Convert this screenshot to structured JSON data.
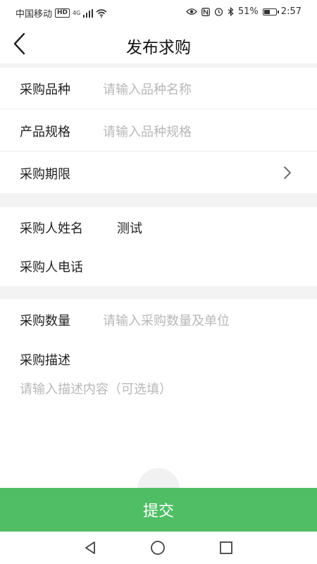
{
  "status_bar": {
    "carrier": "中国移动",
    "hd": "HD",
    "network": "4G",
    "battery_percent": "51%",
    "time": "2:57",
    "battery_level": 0.51
  },
  "header": {
    "title": "发布求购"
  },
  "form": {
    "variety": {
      "label": "采购品种",
      "placeholder": "请输入品种名称"
    },
    "spec": {
      "label": "产品规格",
      "placeholder": "请输入品种规格"
    },
    "period": {
      "label": "采购期限"
    },
    "buyer_name": {
      "label": "采购人姓名",
      "value": "测试"
    },
    "buyer_phone": {
      "label": "采购人电话"
    },
    "quantity": {
      "label": "采购数量",
      "placeholder": "请输入采购数量及单位"
    },
    "description": {
      "label": "采购描述",
      "placeholder": "请输入描述内容（可选填）"
    }
  },
  "submit": {
    "label": "提交"
  },
  "colors": {
    "accent": "#4fbe65",
    "background_gap": "#f3f3f3",
    "placeholder": "#b8b8b8"
  }
}
